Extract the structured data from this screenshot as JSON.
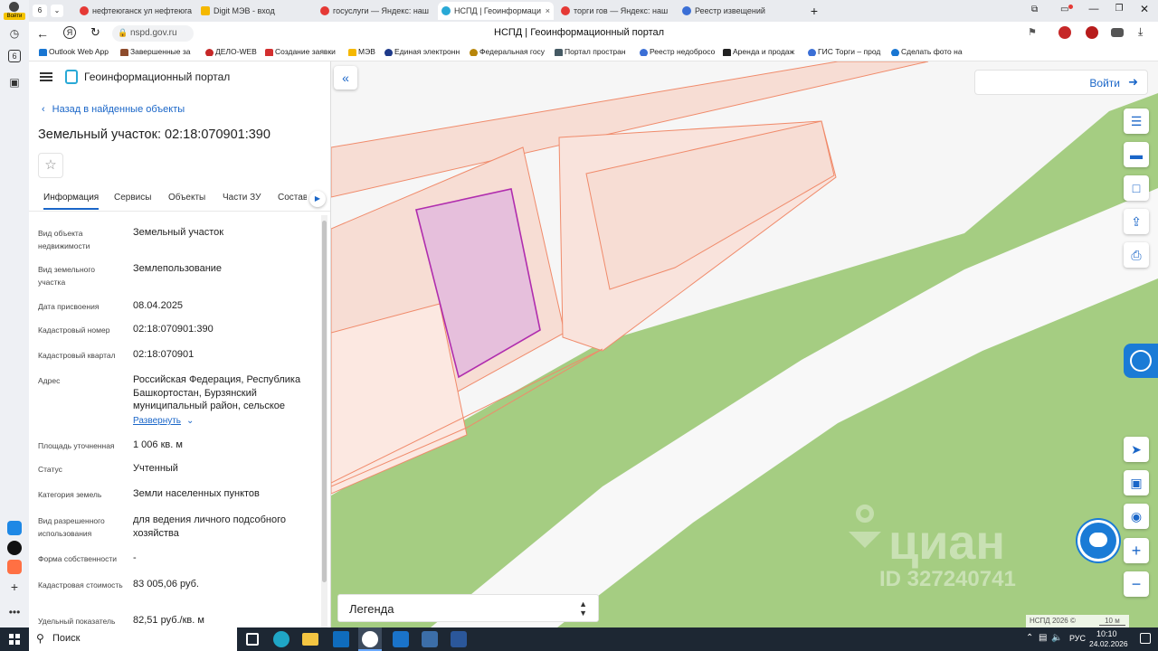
{
  "browser": {
    "tab_count": "6",
    "profile_label": "Войти",
    "tabs": [
      {
        "title": "нефтеюганск ул нефтеюга",
        "color": "#e53935"
      },
      {
        "title": "Digit МЭВ - вход",
        "color": "#f5b800"
      },
      {
        "title": "госуслуги — Яндекс: наш",
        "color": "#e53935"
      },
      {
        "title": "НСПД | Геоинформаци",
        "color": "#29a9d6"
      },
      {
        "title": "торги гов — Яндекс: наш",
        "color": "#e53935"
      },
      {
        "title": "Реестр извещений",
        "color": "#3b6fd6"
      }
    ],
    "close_glyph": "×",
    "new_tab_glyph": "+",
    "url": "nspd.gov.ru",
    "page_title": "НСПД | Геоинформационный портал",
    "bookmarks": [
      {
        "label": "Outlook Web App",
        "color": "#1976d2"
      },
      {
        "label": "Завершенные за",
        "color": "#8d4b2c"
      },
      {
        "label": "ДЕЛО-WEB",
        "color": "#c62828"
      },
      {
        "label": "Создание заявки",
        "color": "#d32f2f"
      },
      {
        "label": "МЭВ",
        "color": "#f5b800"
      },
      {
        "label": "Единая электронн",
        "color": "#1e3a8a"
      },
      {
        "label": "Федеральная госу",
        "color": "#b8860b"
      },
      {
        "label": "Портал простран",
        "color": "#455a64"
      },
      {
        "label": "Реестр недобросо",
        "color": "#3b6fd6"
      },
      {
        "label": "Аренда и продаж",
        "color": "#222"
      },
      {
        "label": "ГИС Торги – прод",
        "color": "#3b6fd6"
      },
      {
        "label": "Сделать фото на",
        "color": "#1976d2"
      }
    ]
  },
  "portal": {
    "name": "Геоинформационный портал",
    "back_label": "Назад в найденные объекты",
    "title": "Земельный участок: 02:18:070901:390",
    "tabs": [
      "Информация",
      "Сервисы",
      "Объекты",
      "Части ЗУ",
      "Состав"
    ],
    "rows": [
      {
        "label": "Вид объекта недвижимости",
        "value": "Земельный участок"
      },
      {
        "label": "Вид земельного участка",
        "value": "Землепользование"
      },
      {
        "label": "Дата присвоения",
        "value": "08.04.2025"
      },
      {
        "label": "Кадастровый номер",
        "value": "02:18:070901:390"
      },
      {
        "label": "Кадастровый квартал",
        "value": "02:18:070901"
      },
      {
        "label": "Адрес",
        "value": "Российская Федерация, Республика Башкортостан, Бурзянский муниципальный район, сельское"
      },
      {
        "label": "Площадь уточненная",
        "value": "1 006 кв. м"
      },
      {
        "label": "Статус",
        "value": "Учтенный"
      },
      {
        "label": "Категория земель",
        "value": "Земли населенных пунктов"
      },
      {
        "label": "Вид разрешенного использования",
        "value": "для ведения личного подсобного хозяйства"
      },
      {
        "label": "Форма собственности",
        "value": "-"
      },
      {
        "label": "Кадастровая стоимость",
        "value": "83 005,06 руб."
      },
      {
        "label": "Удельный показатель",
        "value": "82,51 руб./кв. м"
      }
    ],
    "expand_label": "Развернуть",
    "login_label": "Войти",
    "legend_label": "Легенда",
    "copyright": "НСПД 2026 ©",
    "scale": "10 м",
    "watermark_brand": "циан",
    "watermark_id": "ID 327240741"
  },
  "taskbar": {
    "search_label": "Поиск",
    "lang": "РУС",
    "time": "10:10",
    "date": "24.02.2026"
  }
}
